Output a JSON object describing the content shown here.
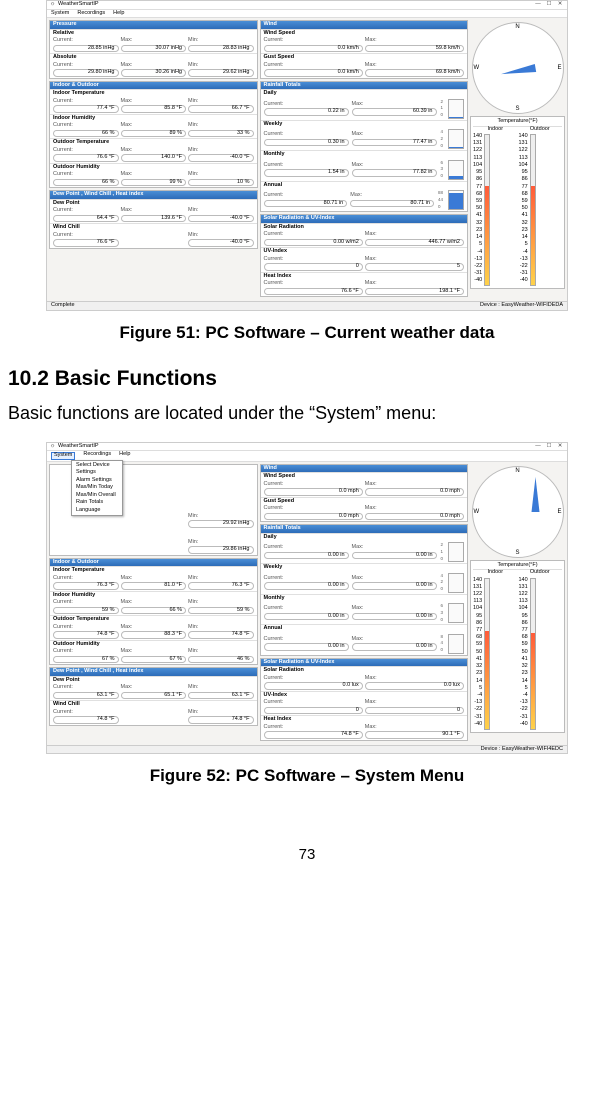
{
  "doc": {
    "caption51": "Figure 51: PC Software – Current weather data",
    "section_heading": "10.2 Basic Functions",
    "body_text": "Basic functions are located under the “System” menu:",
    "caption52": "Figure 52: PC Software – System Menu",
    "page_num": "73"
  },
  "common": {
    "app_title": "WeatherSmartIP",
    "menu_system": "System",
    "menu_recordings": "Recordings",
    "menu_help": "Help",
    "lbl_current": "Current:",
    "lbl_max": "Max:",
    "lbl_min": "Min:",
    "compass": {
      "N": "N",
      "S": "S",
      "E": "E",
      "W": "W"
    },
    "status_complete": "Complete",
    "thermo_title": "Temperature(°F)",
    "thermo_indoor": "Indoor",
    "thermo_outdoor": "Outdoor",
    "thermo_scale": [
      "140",
      "131",
      "122",
      "113",
      "104",
      "95",
      "86",
      "77",
      "68",
      "59",
      "50",
      "41",
      "32",
      "23",
      "14",
      "5",
      "-4",
      "-13",
      "-22",
      "-31",
      "-40"
    ]
  },
  "fig51": {
    "status_device": "Device : EasyWeather-WIFIDEDA",
    "pressure": {
      "hdr": "Pressure",
      "relative": {
        "name": "Relative",
        "cur": "28.85 inHg",
        "max": "30.07 inHg",
        "min": "28.83 inHg"
      },
      "absolute": {
        "name": "Absolute",
        "cur": "29.80 inHg",
        "max": "30.26 inHg",
        "min": "29.62 inHg"
      }
    },
    "indoor_outdoor": {
      "hdr": "Indoor & Outdoor",
      "indoor_temp": {
        "name": "Indoor Temperature",
        "cur": "77.4 °F",
        "max": "85.8 °F",
        "min": "66.7 °F"
      },
      "indoor_hum": {
        "name": "Indoor Humidity",
        "cur": "66 %",
        "max": "89 %",
        "min": "33 %"
      },
      "outdoor_temp": {
        "name": "Outdoor Temperature",
        "cur": "76.6 °F",
        "max": "140.0 °F",
        "min": "-40.0 °F"
      },
      "outdoor_hum": {
        "name": "Outdoor Humidity",
        "cur": "66 %",
        "max": "99 %",
        "min": "10 %"
      }
    },
    "dew": {
      "hdr": "Dew Point , Wind Chill , Heat index",
      "dew_point": {
        "name": "Dew Point",
        "cur": "64.4 °F",
        "max": "139.6 °F",
        "min": "-40.0 °F"
      },
      "wind_chill": {
        "name": "Wind Chill",
        "cur": "76.6 °F",
        "min": "-40.0 °F"
      }
    },
    "wind": {
      "hdr": "Wind",
      "speed": {
        "name": "Wind Speed",
        "cur": "0.0 km/h",
        "max": "59.8 km/h"
      },
      "gust": {
        "name": "Gust Speed",
        "cur": "0.0 km/h",
        "max": "69.8 km/h"
      }
    },
    "rain": {
      "hdr": "Rainfall Totals",
      "daily": {
        "name": "Daily",
        "cur": "0.22 in",
        "max": "60.39 in",
        "g": [
          "2",
          "1",
          "0"
        ],
        "fill": 5
      },
      "weekly": {
        "name": "Weekly",
        "cur": "0.30 in",
        "max": "77.47 in",
        "g": [
          "4",
          "2",
          "0"
        ],
        "fill": 5
      },
      "monthly": {
        "name": "Monthly",
        "cur": "1.54 in",
        "max": "77.82 in",
        "g": [
          "6",
          "3",
          "0"
        ],
        "fill": 15
      },
      "annual": {
        "name": "Annual",
        "cur": "80.71 in",
        "max": "80.71 in",
        "g": [
          "88",
          "44",
          "0"
        ],
        "fill": 90
      }
    },
    "solar": {
      "hdr": "Solar Radiation & UV-Index",
      "rad": {
        "name": "Solar Radiation",
        "cur": "0.00 w/m2",
        "max": "446.77 w/m2"
      },
      "uv": {
        "name": "UV-Index",
        "cur": "0",
        "max": "5"
      },
      "heat": {
        "name": "Heat Index",
        "cur": "76.6 °F",
        "max": "198.1 °F"
      }
    }
  },
  "fig52": {
    "status_device": "Device : EasyWeather-WIFI4EDC",
    "dropdown": [
      "Select Device",
      "Settings",
      "Alarm Settings",
      "Max/Min Today",
      "Max/Min Overall",
      "Rain Totals",
      "Language"
    ],
    "pressure": {
      "relative": {
        "min": "29.92 inHg"
      },
      "absolute": {
        "min": "29.86 inHg"
      }
    },
    "indoor_outdoor": {
      "hdr": "Indoor & Outdoor",
      "indoor_temp": {
        "name": "Indoor Temperature",
        "cur": "76.3 °F",
        "max": "81.0 °F",
        "min": "76.3 °F"
      },
      "indoor_hum": {
        "name": "Indoor Humidity",
        "cur": "59 %",
        "max": "66 %",
        "min": "59 %"
      },
      "outdoor_temp": {
        "name": "Outdoor Temperature",
        "cur": "74.8 °F",
        "max": "88.3 °F",
        "min": "74.8 °F"
      },
      "outdoor_hum": {
        "name": "Outdoor Humidity",
        "cur": "67 %",
        "max": "67 %",
        "min": "46 %"
      }
    },
    "dew": {
      "hdr": "Dew Point , Wind Chill , Heat index",
      "dew_point": {
        "name": "Dew Point",
        "cur": "63.1 °F",
        "max": "65.1 °F",
        "min": "63.1 °F"
      },
      "wind_chill": {
        "name": "Wind Chill",
        "cur": "74.8 °F",
        "min": "74.8 °F"
      }
    },
    "wind": {
      "hdr": "Wind",
      "speed": {
        "name": "Wind Speed",
        "cur": "0.0 mph",
        "max": "0.0 mph"
      },
      "gust": {
        "name": "Gust Speed",
        "cur": "0.0 mph",
        "max": "0.0 mph"
      }
    },
    "rain": {
      "hdr": "Rainfall Totals",
      "daily": {
        "name": "Daily",
        "cur": "0.00 in",
        "max": "0.00 in",
        "g": [
          "2",
          "1",
          "0"
        ],
        "fill": 0
      },
      "weekly": {
        "name": "Weekly",
        "cur": "0.00 in",
        "max": "0.00 in",
        "g": [
          "4",
          "2",
          "0"
        ],
        "fill": 0
      },
      "monthly": {
        "name": "Monthly",
        "cur": "0.00 in",
        "max": "0.00 in",
        "g": [
          "6",
          "3",
          "0"
        ],
        "fill": 0
      },
      "annual": {
        "name": "Annual",
        "cur": "0.00 in",
        "max": "0.00 in",
        "g": [
          "8",
          "4",
          "0"
        ],
        "fill": 0
      }
    },
    "solar": {
      "hdr": "Solar Radiation & UV-Index",
      "rad": {
        "name": "Solar Radiation",
        "cur": "0.0 lux",
        "max": "0.0 lux"
      },
      "uv": {
        "name": "UV-Index",
        "cur": "0",
        "max": "0"
      },
      "heat": {
        "name": "Heat Index",
        "cur": "74.8 °F",
        "max": "90.1 °F"
      }
    }
  }
}
